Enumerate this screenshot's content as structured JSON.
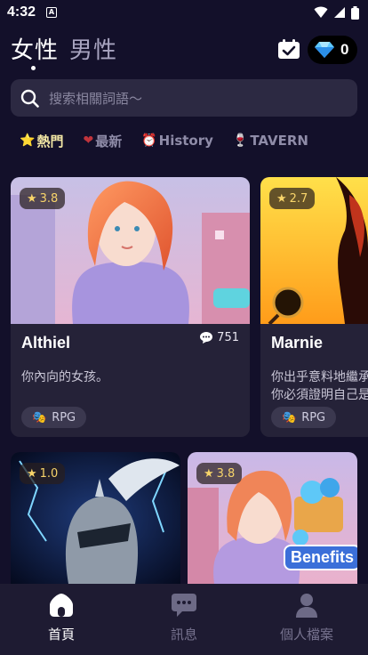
{
  "status_bar": {
    "time": "4:32",
    "app_icon_letter": "A",
    "icons": [
      "wifi-icon",
      "signal-icon",
      "battery-icon"
    ]
  },
  "header": {
    "tabs": [
      {
        "label": "女性",
        "active": true
      },
      {
        "label": "男性",
        "active": false
      }
    ],
    "diamond_count": "0"
  },
  "search": {
    "placeholder": "搜索相關詞語～"
  },
  "categories": [
    {
      "emoji": "⭐",
      "label": "熱門",
      "active": true
    },
    {
      "emoji": "❤",
      "label": "最新",
      "active": false
    },
    {
      "emoji": "⏰",
      "label": "History",
      "active": false
    },
    {
      "emoji": "🍷",
      "label": "TAVERN",
      "active": false
    }
  ],
  "cards": [
    {
      "name": "Althiel",
      "rating": "3.8",
      "chat_count": "751",
      "description": "你內向的女孩。",
      "tag": "RPG"
    },
    {
      "name": "Marnie",
      "rating": "2.7",
      "description_lines": [
        "你出乎意料地繼承",
        "你必須證明自己是"
      ],
      "tag": "RPG"
    },
    {
      "rating": "1.0"
    },
    {
      "rating": "3.8",
      "overlay_label": "Benefits"
    }
  ],
  "bottom_nav": [
    {
      "label": "首頁",
      "active": true
    },
    {
      "label": "訊息",
      "active": false
    },
    {
      "label": "個人檔案",
      "active": false
    }
  ],
  "colors": {
    "background": "#13102a",
    "card": "#252238",
    "accent_gold": "#f5e9a6",
    "rating": "#f7d46a"
  }
}
